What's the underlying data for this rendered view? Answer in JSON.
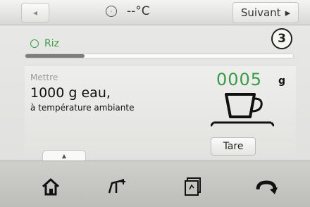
{
  "header": {
    "back_label": "◂",
    "temperature": "--°C",
    "next_label": "Suivant",
    "next_arrow": "▸"
  },
  "recipe": {
    "name": "Riz",
    "step_number": "3",
    "progress_fraction": 0.22
  },
  "instruction": {
    "label": "Mettre",
    "main": "1000 g eau,",
    "sub": "à température ambiante"
  },
  "scale": {
    "weight": "0005",
    "unit": "g",
    "tare_label": "Tare"
  },
  "panel": {
    "handle_glyph": "▲"
  },
  "icons": {
    "back": "back-arrow-icon",
    "timer": "timer-icon",
    "recipe": "recipe-icon",
    "next": "next-arrow-icon",
    "cup": "cup-icon",
    "home": "home-icon",
    "scale": "scale-icon",
    "tablet": "tablet-icon",
    "rotate": "rotate-icon"
  },
  "colors": {
    "accent_green": "#3a9a4a",
    "text_dark": "#111111",
    "muted": "#9b9b98"
  }
}
